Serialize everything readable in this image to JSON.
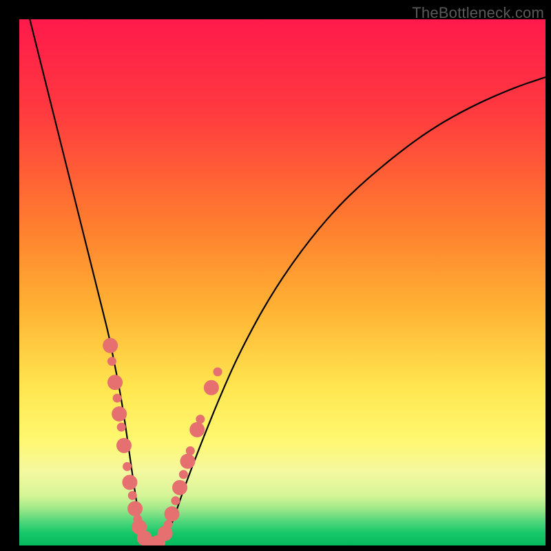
{
  "watermark": {
    "text": "TheBottleneck.com"
  },
  "chart_data": {
    "type": "line",
    "title": "",
    "xlabel": "",
    "ylabel": "",
    "xlim": [
      0,
      100
    ],
    "ylim": [
      0,
      100
    ],
    "grid": false,
    "background_gradient": {
      "stops": [
        {
          "pos": 0.0,
          "color": "#ff1a4b"
        },
        {
          "pos": 0.18,
          "color": "#ff3b3f"
        },
        {
          "pos": 0.38,
          "color": "#ff7a2f"
        },
        {
          "pos": 0.55,
          "color": "#ffb233"
        },
        {
          "pos": 0.7,
          "color": "#ffe650"
        },
        {
          "pos": 0.8,
          "color": "#fff870"
        },
        {
          "pos": 0.86,
          "color": "#f4f8a0"
        },
        {
          "pos": 0.905,
          "color": "#d6f596"
        },
        {
          "pos": 0.93,
          "color": "#9ee88a"
        },
        {
          "pos": 0.955,
          "color": "#4fd67a"
        },
        {
          "pos": 0.975,
          "color": "#18c86a"
        },
        {
          "pos": 1.0,
          "color": "#06b85e"
        }
      ]
    },
    "series": [
      {
        "name": "curve",
        "color": "#000000",
        "stroke_width": 2.2,
        "x": [
          2,
          4,
          6,
          8,
          10,
          12,
          14,
          16,
          17,
          18,
          19,
          20,
          21,
          22,
          23,
          24,
          25,
          27,
          29,
          31,
          34,
          38,
          42,
          48,
          55,
          62,
          70,
          78,
          86,
          94,
          100
        ],
        "y": [
          100,
          92,
          84,
          76,
          68,
          60,
          52,
          44,
          40,
          35,
          30,
          24,
          17,
          10,
          4,
          0,
          0,
          0,
          4,
          10,
          18,
          28,
          37,
          48,
          58,
          66,
          73,
          79,
          83.5,
          87,
          89
        ]
      }
    ],
    "markers": {
      "name": "scatter-points",
      "color": "#e6706f",
      "radius_small": 6.5,
      "radius_large": 11,
      "points": [
        {
          "x": 17.3,
          "y": 38,
          "r": "large"
        },
        {
          "x": 17.6,
          "y": 35,
          "r": "small"
        },
        {
          "x": 18.2,
          "y": 31,
          "r": "large"
        },
        {
          "x": 18.6,
          "y": 28,
          "r": "small"
        },
        {
          "x": 19.0,
          "y": 25,
          "r": "large"
        },
        {
          "x": 19.4,
          "y": 22.5,
          "r": "small"
        },
        {
          "x": 19.9,
          "y": 19,
          "r": "large"
        },
        {
          "x": 20.5,
          "y": 15,
          "r": "small"
        },
        {
          "x": 21.0,
          "y": 12,
          "r": "large"
        },
        {
          "x": 21.5,
          "y": 9.5,
          "r": "small"
        },
        {
          "x": 22.0,
          "y": 7,
          "r": "large"
        },
        {
          "x": 22.5,
          "y": 5,
          "r": "small"
        },
        {
          "x": 22.8,
          "y": 3.5,
          "r": "large"
        },
        {
          "x": 23.3,
          "y": 2.3,
          "r": "small"
        },
        {
          "x": 23.8,
          "y": 1.4,
          "r": "large"
        },
        {
          "x": 24.3,
          "y": 0.8,
          "r": "small"
        },
        {
          "x": 25.0,
          "y": 0.3,
          "r": "large"
        },
        {
          "x": 25.7,
          "y": 0.3,
          "r": "small"
        },
        {
          "x": 26.3,
          "y": 0.5,
          "r": "large"
        },
        {
          "x": 27.0,
          "y": 1.2,
          "r": "small"
        },
        {
          "x": 27.7,
          "y": 2.3,
          "r": "large"
        },
        {
          "x": 28.3,
          "y": 4.0,
          "r": "small"
        },
        {
          "x": 29.0,
          "y": 6.0,
          "r": "large"
        },
        {
          "x": 29.7,
          "y": 8.5,
          "r": "small"
        },
        {
          "x": 30.5,
          "y": 11,
          "r": "large"
        },
        {
          "x": 31.2,
          "y": 13.5,
          "r": "small"
        },
        {
          "x": 32.0,
          "y": 16,
          "r": "large"
        },
        {
          "x": 32.5,
          "y": 18,
          "r": "small"
        },
        {
          "x": 33.8,
          "y": 22,
          "r": "large"
        },
        {
          "x": 34.4,
          "y": 24,
          "r": "small"
        },
        {
          "x": 36.5,
          "y": 30,
          "r": "large"
        },
        {
          "x": 37.7,
          "y": 33,
          "r": "small"
        }
      ]
    }
  }
}
